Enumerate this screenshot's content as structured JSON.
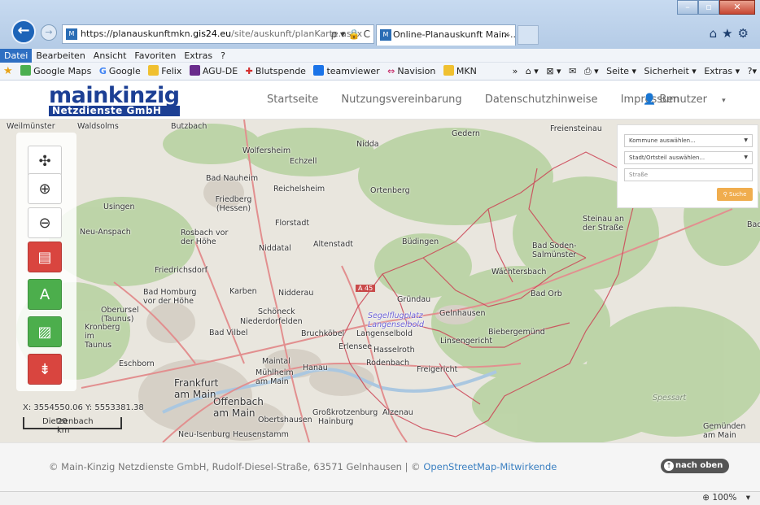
{
  "browser": {
    "url_prefix": "https://planauskunftmkn.",
    "url_host": "gis24.eu",
    "url_path": "/site/auskunft/planKarte.aspx",
    "url_icons": "ρ ▾ 🔒 C",
    "tab_title": "Online-Planauskunft Main-...",
    "tab_close": "×",
    "back_icon": "←",
    "forward_icon": "→",
    "window_controls": [
      "–",
      "▫",
      "✕"
    ],
    "right_tools": "⌂★⚙"
  },
  "menubar": {
    "items": [
      "Datei",
      "Bearbeiten",
      "Ansicht",
      "Favoriten",
      "Extras",
      "?"
    ]
  },
  "favorites": {
    "items": [
      "Google Maps",
      "Google",
      "Felix",
      "AGU-DE",
      "Blutspende",
      "teamviewer",
      "Navision",
      "MKN"
    ],
    "tools": [
      "»",
      "⌂ ▾",
      "⊠ ▾",
      "✉",
      "⎙ ▾",
      "Seite ▾",
      "Sicherheit ▾",
      "Extras ▾",
      "?▾"
    ]
  },
  "site": {
    "logo_main": "mainkinzig",
    "logo_sub": "Netzdienste GmbH",
    "nav": [
      "Startseite",
      "Nutzungsvereinbarung",
      "Datenschutzhinweise",
      "Impressum"
    ],
    "user_label": "Benutzer",
    "user_icon": "👤",
    "user_caret": "▾"
  },
  "map_tools": {
    "pan": "✣",
    "zoom_in": "⊕",
    "zoom_out": "⊖",
    "layers": "▤",
    "road": "A",
    "image": "▨",
    "legend": "⇟"
  },
  "map_labels": [
    "Weilmünster",
    "Waldsolms",
    "Butzbach",
    "Gedern",
    "Freiensteinau",
    "Wolfersheim",
    "Nidda",
    "Echzell",
    "Usingen",
    "Bad Nauheim",
    "Reichelsheim",
    "Ortenberg",
    "Friedberg (Hessen)",
    "Florstadt",
    "Neu-Anspach",
    "Rosbach vor der Höhe",
    "Niddatal",
    "Altenstadt",
    "Büdingen",
    "Steinau an der Straße",
    "Bad Soden-Salmünster",
    "Friedrichsdorf",
    "Wächtersbach",
    "Bad Homburg vor der Höhe",
    "Karben",
    "Nidderau",
    "Gründau",
    "Bad Orb",
    "A 45",
    "Oberursel (Taunus)",
    "Schöneck",
    "Niederdorfelden",
    "Gelnhausen",
    "Kronberg im Taunus",
    "Bad Vilbel",
    "Bruchköbel",
    "Langenselbold",
    "Biebergemünd",
    "Linsengericht",
    "Erlensee",
    "Hasselroth",
    "Eschborn",
    "Maintal",
    "Hanau",
    "Rodenbach",
    "Freigericht",
    "Frankfurt am Main",
    "Mühlheim am Main",
    "Offenbach am Main",
    "Obertshausen",
    "Großkrotzenburg",
    "Alzenau",
    "Hainburg",
    "Neu-Isenburg",
    "Heusenstamm",
    "Spessart",
    "Gemünden am Main",
    "Bad",
    "Segelflugplatz Langenselbold",
    "Gelnhausen"
  ],
  "search": {
    "kommune": "Kommune auswählen...",
    "stadt": "Stadt/Ortsteil auswählen...",
    "strasse_placeholder": "Straße",
    "button": "Suche",
    "button_icon": "⚲"
  },
  "coords": "X: 3554550.06  Y: 5553381.38",
  "scale": "20 km",
  "scale_overlap": "Dietzenbach",
  "footer": {
    "text": "© Main-Kinzig Netzdienste GmbH, Rudolf-Diesel-Straße, 63571 Gelnhausen | ©",
    "osm": "OpenStreetMap-Mitwirkende",
    "top_button": "nach oben",
    "top_icon": "⇡"
  },
  "status": {
    "zoom": "100%",
    "zoom_icon": "⊕",
    "zoom_caret": "▾"
  }
}
